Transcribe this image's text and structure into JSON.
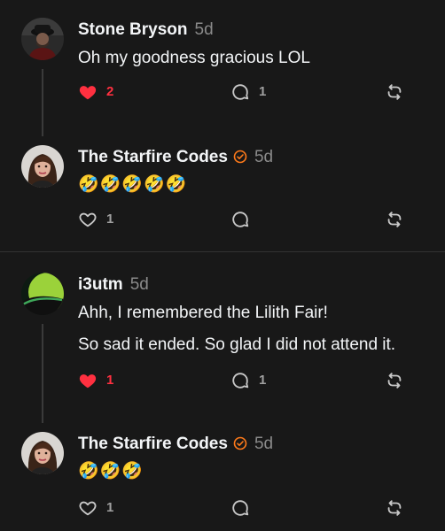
{
  "posts": [
    {
      "author": "Stone Bryson",
      "time": "5d",
      "verified": false,
      "lines": [
        "Oh my goodness gracious LOL"
      ],
      "like_count": "2",
      "liked": true,
      "reply_count": "1",
      "avatar_icon": "person-dark-avatar"
    },
    {
      "author": "The Starfire Codes",
      "time": "5d",
      "verified": true,
      "lines": [
        "🤣🤣🤣🤣🤣"
      ],
      "like_count": "1",
      "liked": false,
      "reply_count": "",
      "avatar_icon": "woman-portrait-avatar"
    },
    {
      "author": "i3utm",
      "time": "5d",
      "verified": false,
      "lines": [
        "Ahh, I remembered the Lilith Fair!",
        "So sad it ended. So glad I did not attend it."
      ],
      "like_count": "1",
      "liked": true,
      "reply_count": "1",
      "avatar_icon": "green-planet-avatar"
    },
    {
      "author": "The Starfire Codes",
      "time": "5d",
      "verified": true,
      "lines": [
        "🤣🤣🤣"
      ],
      "like_count": "1",
      "liked": false,
      "reply_count": "",
      "avatar_icon": "woman-portrait-avatar"
    }
  ],
  "colors": {
    "background": "#181818",
    "liked": "#ff3040",
    "muted": "#8a8a8a",
    "verified": "#ff7a1a"
  }
}
